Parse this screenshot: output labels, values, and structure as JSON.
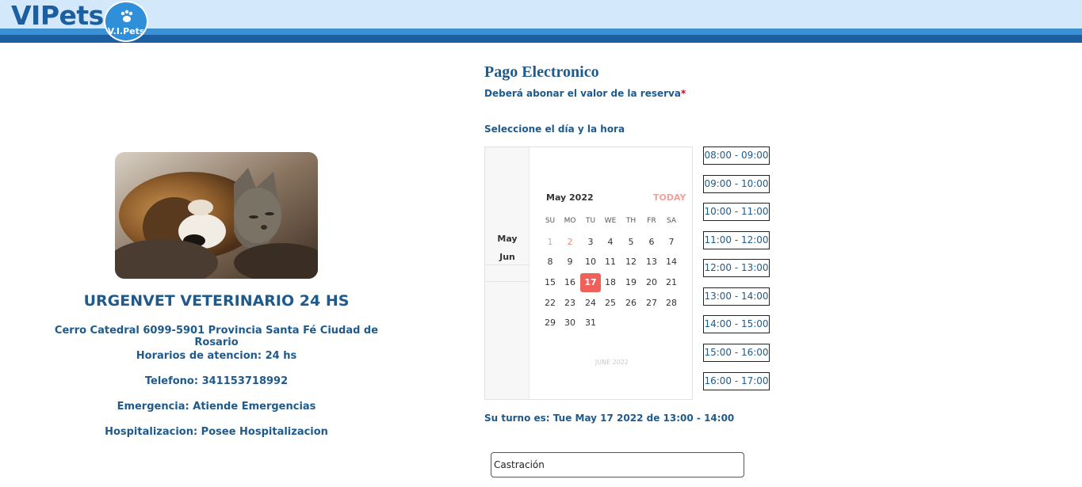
{
  "header": {
    "brand": "VIPets",
    "logo_text": "V.I.Pets",
    "logo_icon": "paw-icon",
    "colors": {
      "header_bg": "#d4e8fb",
      "stripe_light": "#3b8fd4",
      "stripe_dark": "#1b5fa0"
    }
  },
  "clinic": {
    "photo": "dog-and-cat-photo",
    "name": "URGENVET VETERINARIO 24 HS",
    "address": "Cerro Catedral 6099-5901 Provincia Santa Fé Ciudad de Rosario",
    "hours": "Horarios de atencion: 24 hs",
    "phone": "Telefono: 341153718992",
    "emergency": "Emergencia: Atiende Emergencias",
    "hospitalization": "Hospitalizacion: Posee Hospitalizacion"
  },
  "payment": {
    "title": "Pago Electronico",
    "subtitle": "Deberá abonar el valor de la reserva",
    "required_mark": "*",
    "select_label": "Seleccione el día y la hora"
  },
  "calendar": {
    "side_months": [
      "May",
      "Jun"
    ],
    "month_title": "May 2022",
    "today_label": "TODAY",
    "weekdays": [
      "SU",
      "MO",
      "TU",
      "WE",
      "TH",
      "FR",
      "SA"
    ],
    "weeks": [
      [
        "1",
        "2",
        "3",
        "4",
        "5",
        "6",
        "7"
      ],
      [
        "8",
        "9",
        "10",
        "11",
        "12",
        "13",
        "14"
      ],
      [
        "15",
        "16",
        "17",
        "18",
        "19",
        "20",
        "21"
      ],
      [
        "22",
        "23",
        "24",
        "25",
        "26",
        "27",
        "28"
      ],
      [
        "29",
        "30",
        "31",
        "",
        "",
        "",
        ""
      ]
    ],
    "selected_day": "17",
    "next_month_label": "JUNE 2022",
    "accent_color": "#f0605a"
  },
  "time_slots": [
    "08:00 - 09:00",
    "09:00 - 10:00",
    "10:00 - 11:00",
    "11:00 - 12:00",
    "12:00 - 13:00",
    "13:00 - 14:00",
    "14:00 - 15:00",
    "15:00 - 16:00",
    "16:00 - 17:00"
  ],
  "turn": {
    "summary": "Su turno es: Tue May 17 2022 de 13:00 - 14:00"
  },
  "service": {
    "value": "Castración"
  }
}
